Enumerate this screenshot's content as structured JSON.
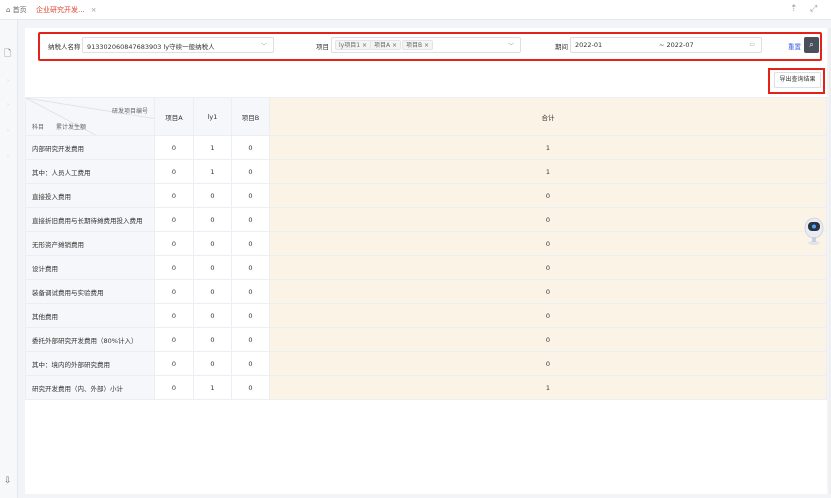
{
  "tabs": {
    "home": "⌂ 首页",
    "active": "企业研究开发...",
    "close": "×"
  },
  "filter": {
    "taxpayer_label": "纳税人名称",
    "taxpayer_value": "913302060847683903 ly守续一般纳税人",
    "project_label": "项目",
    "project_tags": [
      "ly项目1 ×",
      "项目A ×",
      "项目B ×"
    ],
    "period_label": "期间",
    "period_start": "2022-01",
    "period_end": "~ 2022-07",
    "reset_label": "重置",
    "search_icon": "search-icon"
  },
  "export_label": "导出查询结果",
  "table": {
    "header_top_right": "研发项目编号",
    "header_middle": "累计发生额",
    "header_bottom_left": "科目",
    "columns": [
      "项目A",
      "ly1",
      "项目B"
    ],
    "total_label": "合计",
    "rows": [
      {
        "name": "内部研究开发费用",
        "values": [
          "0",
          "1",
          "0"
        ],
        "total": "1"
      },
      {
        "name": "其中：人员人工费用",
        "values": [
          "0",
          "1",
          "0"
        ],
        "total": "1"
      },
      {
        "name": "直接投入费用",
        "values": [
          "0",
          "0",
          "0"
        ],
        "total": "0"
      },
      {
        "name": "直接折旧费用与长期待摊费用投入费用",
        "values": [
          "0",
          "0",
          "0"
        ],
        "total": "0"
      },
      {
        "name": "无形资产摊销费用",
        "values": [
          "0",
          "0",
          "0"
        ],
        "total": "0"
      },
      {
        "name": "设计费用",
        "values": [
          "0",
          "0",
          "0"
        ],
        "total": "0"
      },
      {
        "name": "装备调试费用与实验费用",
        "values": [
          "0",
          "0",
          "0"
        ],
        "total": "0"
      },
      {
        "name": "其他费用",
        "values": [
          "0",
          "0",
          "0"
        ],
        "total": "0"
      },
      {
        "name": "委托外部研究开发费用（80%计入）",
        "values": [
          "0",
          "0",
          "0"
        ],
        "total": "0"
      },
      {
        "name": "其中：境内的外部研究费用",
        "values": [
          "0",
          "0",
          "0"
        ],
        "total": "0"
      },
      {
        "name": "研究开发费用（内、外部）小计",
        "values": [
          "0",
          "1",
          "0"
        ],
        "total": "1"
      }
    ]
  },
  "colors": {
    "accent_red": "#e5221a",
    "total_bg": "#fbf4e6"
  }
}
